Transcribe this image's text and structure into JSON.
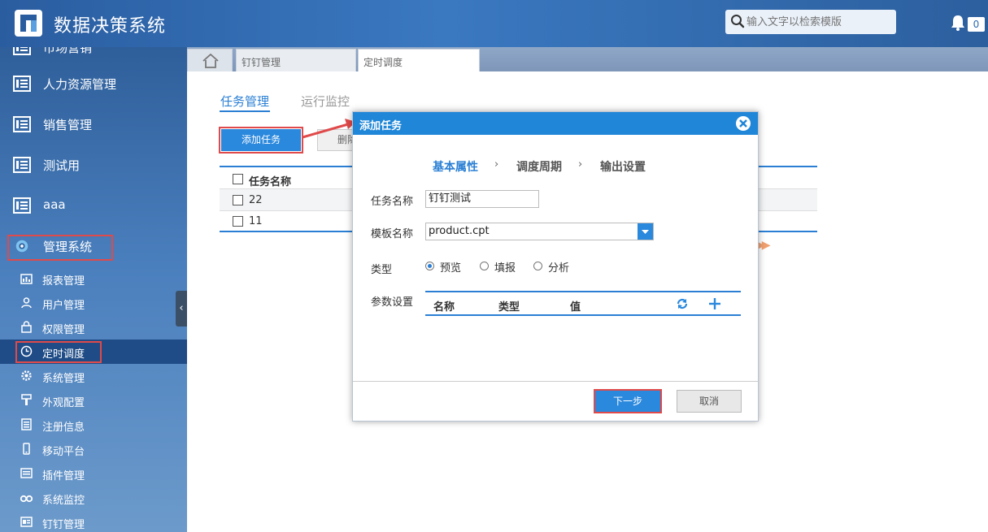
{
  "header": {
    "app_title": "数据决策系统",
    "search_placeholder": "输入文字以检索模版",
    "notification_count": "0"
  },
  "sidebar": {
    "partial_top_label": "市场营销",
    "main_items": [
      {
        "label": "人力资源管理"
      },
      {
        "label": "销售管理"
      },
      {
        "label": "测试用"
      },
      {
        "label": "aaa"
      },
      {
        "label": "管理系统"
      }
    ],
    "sub_items": [
      {
        "label": "报表管理",
        "icon": "report-icon"
      },
      {
        "label": "用户管理",
        "icon": "user-icon"
      },
      {
        "label": "权限管理",
        "icon": "lock-icon"
      },
      {
        "label": "定时调度",
        "icon": "clock-icon",
        "active": true
      },
      {
        "label": "系统管理",
        "icon": "gear-icon"
      },
      {
        "label": "外观配置",
        "icon": "brush-icon"
      },
      {
        "label": "注册信息",
        "icon": "register-icon"
      },
      {
        "label": "移动平台",
        "icon": "mobile-icon"
      },
      {
        "label": "插件管理",
        "icon": "plugin-icon"
      },
      {
        "label": "系统监控",
        "icon": "binoculars-icon"
      },
      {
        "label": "钉钉管理",
        "icon": "dingtalk-icon"
      }
    ]
  },
  "tabs": [
    {
      "label": "钉钉管理"
    },
    {
      "label": "定时调度",
      "active": true
    }
  ],
  "main": {
    "subtabs": [
      {
        "label": "任务管理",
        "active": true
      },
      {
        "label": "运行监控"
      }
    ],
    "add_button": "添加任务",
    "delete_button": "删除",
    "table": {
      "header": "任务名称",
      "rows": [
        "22",
        "11"
      ]
    }
  },
  "dialog": {
    "title": "添加任务",
    "steps": [
      "基本属性",
      "调度周期",
      "输出设置"
    ],
    "step_separator": "›",
    "fields": {
      "task_name_label": "任务名称",
      "task_name_value": "钉钉测试",
      "template_label": "模板名称",
      "template_value": "product.cpt",
      "type_label": "类型",
      "type_options": [
        {
          "label": "预览",
          "selected": true
        },
        {
          "label": "填报"
        },
        {
          "label": "分析"
        }
      ],
      "params_label": "参数设置",
      "params_headers": [
        "名称",
        "类型",
        "值"
      ]
    },
    "next_button": "下一步",
    "cancel_button": "取消"
  },
  "colors": {
    "accent": "#2a88dd",
    "header_bg": "#2a5da0",
    "highlight": "#e04a4a"
  }
}
